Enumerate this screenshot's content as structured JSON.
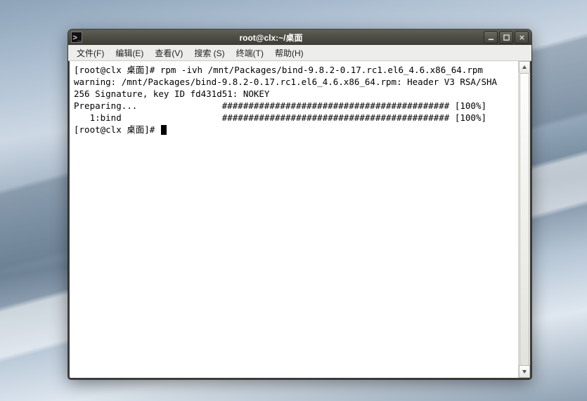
{
  "window": {
    "title": "root@clx:~/桌面"
  },
  "menubar": {
    "items": [
      {
        "label": "文件(F)"
      },
      {
        "label": "编辑(E)"
      },
      {
        "label": "查看(V)"
      },
      {
        "label": "搜索 (S)"
      },
      {
        "label": "终端(T)"
      },
      {
        "label": "帮助(H)"
      }
    ]
  },
  "terminal": {
    "lines": [
      "[root@clx 桌面]# rpm -ivh /mnt/Packages/bind-9.8.2-0.17.rc1.el6_4.6.x86_64.rpm",
      "warning: /mnt/Packages/bind-9.8.2-0.17.rc1.el6_4.6.x86_64.rpm: Header V3 RSA/SHA",
      "256 Signature, key ID fd431d51: NOKEY",
      "Preparing...                ########################################### [100%]",
      "   1:bind                   ########################################### [100%]"
    ],
    "prompt": "[root@clx 桌面]# "
  }
}
